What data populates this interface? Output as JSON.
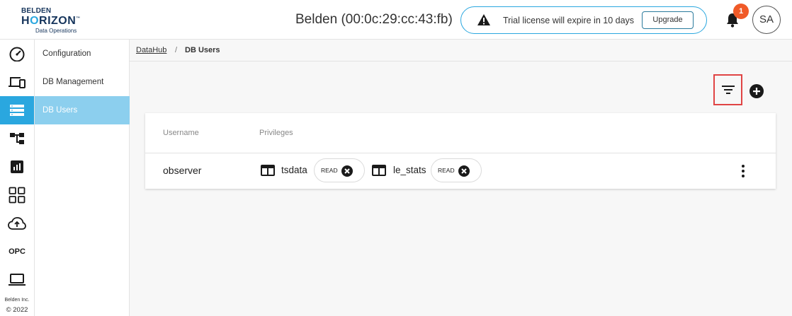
{
  "header": {
    "logo": {
      "line1": "BELDEN",
      "line2_a": "H",
      "line2_o": "O",
      "line2_b": "RIZON",
      "tm": "™",
      "line3": "Data Operations"
    },
    "device_title": "Belden (00:0c:29:cc:43:fb)",
    "trial": {
      "message": "Trial license will expire in 10 days",
      "upgrade_label": "Upgrade"
    },
    "notifications_count": "1",
    "avatar_initials": "SA"
  },
  "rail": {
    "items": [
      {
        "icon": "dashboard-gauge-icon"
      },
      {
        "icon": "devices-icon"
      },
      {
        "icon": "database-icon",
        "active": true
      },
      {
        "icon": "hierarchy-icon"
      },
      {
        "icon": "report-chart-icon"
      },
      {
        "icon": "apps-grid-icon"
      },
      {
        "icon": "cloud-upload-icon"
      },
      {
        "label": "OPC"
      },
      {
        "icon": "laptop-icon"
      }
    ],
    "copyright_line1": "Belden Inc.",
    "copyright_line2": "© 2022"
  },
  "subnav": {
    "items": [
      {
        "label": "Configuration"
      },
      {
        "label": "DB Management"
      },
      {
        "label": "DB Users",
        "active": true
      }
    ]
  },
  "breadcrumb": {
    "root": "DataHub",
    "separator": "/",
    "current": "DB Users"
  },
  "table": {
    "headers": {
      "username": "Username",
      "privileges": "Privileges"
    },
    "rows": [
      {
        "username": "observer",
        "privileges": [
          {
            "db": "tsdata",
            "access": "READ"
          },
          {
            "db": "le_stats",
            "access": "READ"
          }
        ]
      }
    ]
  },
  "colors": {
    "accent": "#2aa7df",
    "accent_light": "#8ccfee",
    "brand_dark": "#16355c",
    "badge": "#f05a28",
    "highlight": "#e04444"
  }
}
